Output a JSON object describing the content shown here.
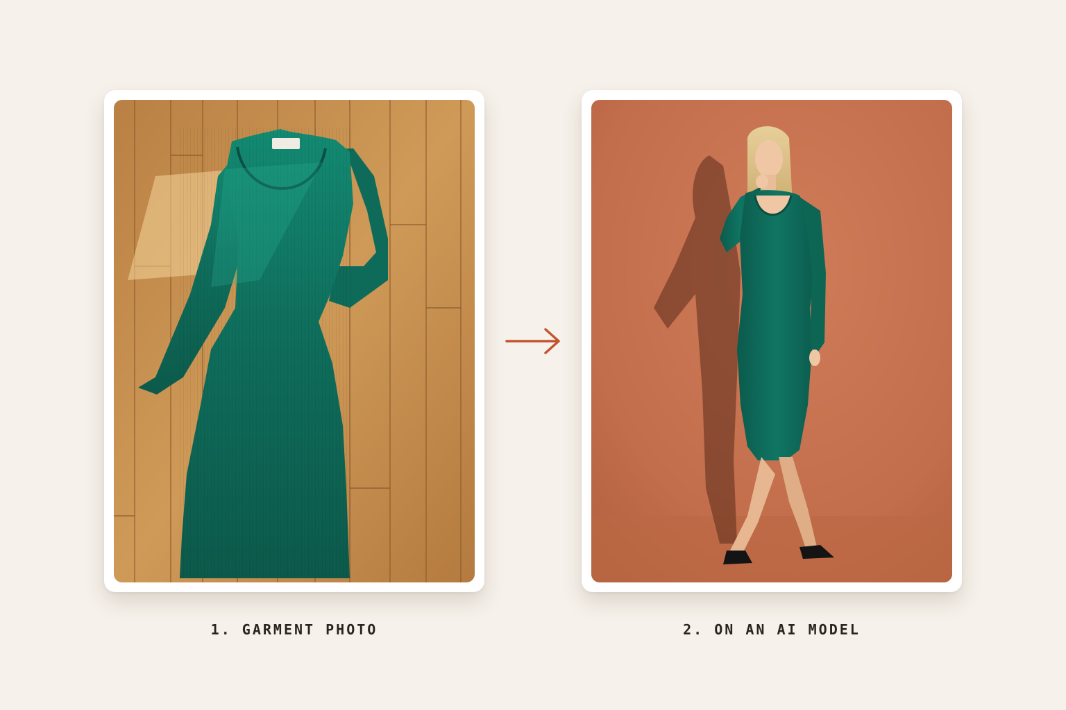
{
  "steps": [
    {
      "number": "1.",
      "label": "1. GARMENT PHOTO",
      "image": "flat-lay green ribbed long-sleeve dress on wooden floor"
    },
    {
      "number": "2.",
      "label": "2. ON AN AI MODEL",
      "image": "model wearing the green ribbed dress against terracotta wall"
    }
  ],
  "arrow_icon": "arrow-right-icon",
  "colors": {
    "background": "#f6f1ea",
    "card": "#ffffff",
    "accent_arrow": "#c2552f",
    "dress_green": "#0f6b5a",
    "floor_wood": "#c8914d",
    "wall_terracotta": "#c6714f",
    "caption_text": "#2b2320"
  }
}
